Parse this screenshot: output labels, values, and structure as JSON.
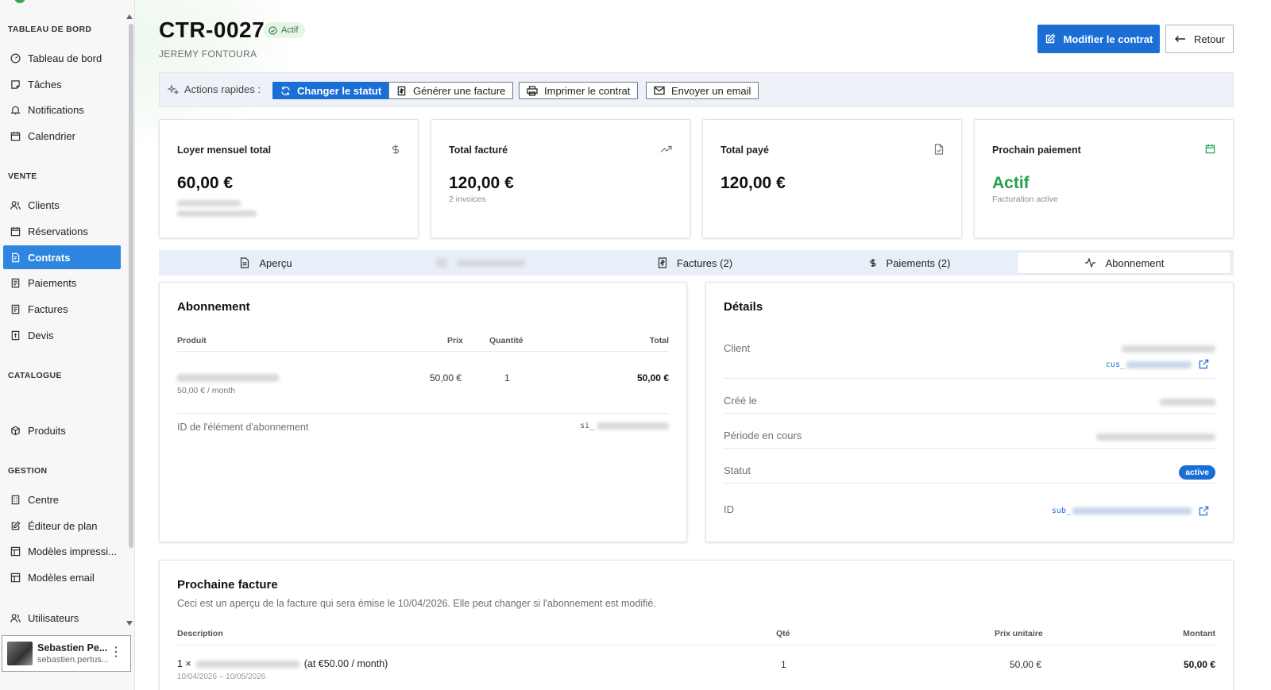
{
  "sidebar": {
    "sections": {
      "dashboard": "TABLEAU DE BORD",
      "sales": "VENTE",
      "catalog": "CATALOGUE",
      "management": "GESTION"
    },
    "items": [
      {
        "label": "Tableau de bord",
        "icon": "gauge-icon"
      },
      {
        "label": "Tâches",
        "icon": "task-icon"
      },
      {
        "label": "Notifications",
        "icon": "bell-icon"
      },
      {
        "label": "Calendrier",
        "icon": "calendar-icon"
      },
      {
        "label": "Clients",
        "icon": "users-icon"
      },
      {
        "label": "Réservations",
        "icon": "calendar-icon"
      },
      {
        "label": "Contrats",
        "icon": "contract-icon"
      },
      {
        "label": "Paiements",
        "icon": "receipt-icon"
      },
      {
        "label": "Factures",
        "icon": "receipt-icon"
      },
      {
        "label": "Devis",
        "icon": "quote-icon"
      },
      {
        "label": "Produits",
        "icon": "package-icon"
      },
      {
        "label": "Centre",
        "icon": "building-icon"
      },
      {
        "label": "Éditeur de plan",
        "icon": "edit-icon"
      },
      {
        "label": "Modèles impressi...",
        "icon": "template-icon"
      },
      {
        "label": "Modèles email",
        "icon": "template-icon"
      },
      {
        "label": "Utilisateurs",
        "icon": "users-icon"
      }
    ],
    "active_item": "Contrats",
    "user": {
      "name": "Sebastien Pe...",
      "email": "sebastien.pertus..."
    }
  },
  "header": {
    "title": "CTR-0027",
    "status": "Actif",
    "subtitle": "JEREMY FONTOURA",
    "edit_button": "Modifier le contrat",
    "back_button": "Retour"
  },
  "quick_actions": {
    "label": "Actions rapides :",
    "buttons": [
      "Changer le statut",
      "Générer une facture",
      "Imprimer le contrat",
      "Envoyer un email"
    ]
  },
  "stats": [
    {
      "label": "Loyer mensuel total",
      "value": "60,00 €",
      "sub": "",
      "icon": "dollar-icon"
    },
    {
      "label": "Total facturé",
      "value": "120,00 €",
      "sub": "2 invoices",
      "icon": "trending-up-icon"
    },
    {
      "label": "Total payé",
      "value": "120,00 €",
      "sub": "",
      "icon": "file-check-icon"
    },
    {
      "label": "Prochain paiement",
      "value": "Actif",
      "sub": "Facturation active",
      "icon": "calendar-icon"
    }
  ],
  "tabs": [
    {
      "label": "Aperçu",
      "icon": "document-icon"
    },
    {
      "label": "",
      "icon": "box-icon"
    },
    {
      "label": "Factures (2)",
      "icon": "receipt-icon"
    },
    {
      "label": "Paiements (2)",
      "icon": "dollar-icon"
    },
    {
      "label": "Abonnement",
      "icon": "activity-icon",
      "active": true
    }
  ],
  "subscription": {
    "title": "Abonnement",
    "columns": [
      "Produit",
      "Prix",
      "Quantité",
      "Total"
    ],
    "row": {
      "price_period": "50,00 € / month",
      "price": "50,00 €",
      "quantity": "1",
      "total": "50,00 €"
    },
    "item_id_label": "ID de l'élément d'abonnement",
    "item_id_prefix": "si_"
  },
  "details": {
    "title": "Détails",
    "client_label": "Client",
    "client_id_prefix": "cus_",
    "created_label": "Créé le",
    "period_label": "Période en cours",
    "status_label": "Statut",
    "status_value": "active",
    "id_label": "ID",
    "id_prefix": "sub_"
  },
  "next_invoice": {
    "title": "Prochaine facture",
    "description": "Ceci est un aperçu de la facture qui sera émise le 10/04/2026. Elle peut changer si l'abonnement est modifié.",
    "columns": [
      "Description",
      "Qté",
      "Prix unitaire",
      "Montant"
    ],
    "row": {
      "prefix": "1 ×",
      "suffix": "(at €50.00 / month)",
      "qty": "1",
      "unit_price": "50,00 €",
      "amount": "50,00 €",
      "dates": "10/04/2026 – 10/05/2026"
    }
  },
  "colors": {
    "primary": "#1b6ed6",
    "active_sidebar": "#2f86e0",
    "success": "#22a04b"
  }
}
